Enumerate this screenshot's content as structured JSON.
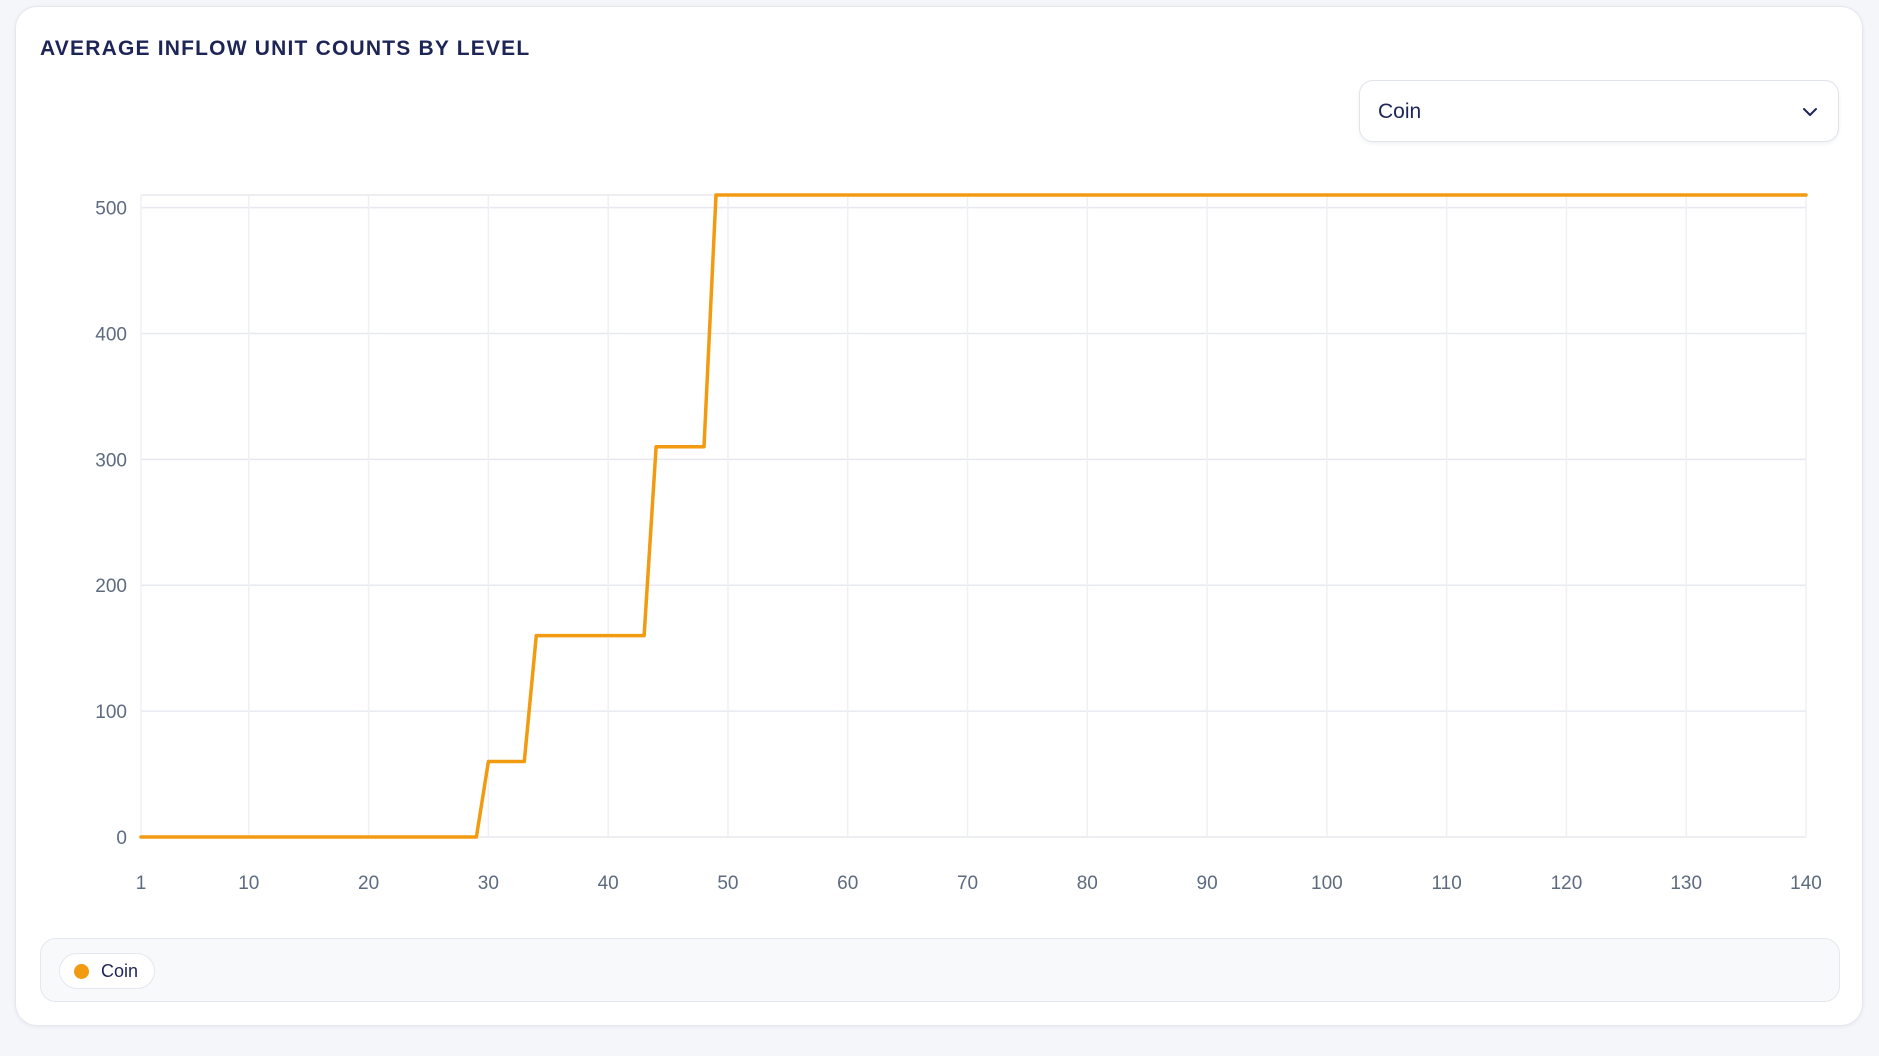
{
  "card": {
    "title": "AVERAGE INFLOW UNIT COUNTS BY LEVEL"
  },
  "dropdown": {
    "selected": "Coin",
    "icon": "chevron-down-icon"
  },
  "legend": {
    "items": [
      {
        "label": "Coin",
        "color": "#f29a10"
      }
    ]
  },
  "chart_data": {
    "type": "line",
    "title": "AVERAGE INFLOW UNIT COUNTS BY LEVEL",
    "xlabel": "",
    "ylabel": "",
    "xlim": [
      1,
      140
    ],
    "ylim": [
      0,
      510
    ],
    "x_ticks": [
      1,
      10,
      20,
      30,
      40,
      50,
      60,
      70,
      80,
      90,
      100,
      110,
      120,
      130,
      140
    ],
    "y_ticks": [
      0,
      100,
      200,
      300,
      400,
      500
    ],
    "grid": true,
    "legend_position": "bottom",
    "series": [
      {
        "name": "Coin",
        "color": "#f29a10",
        "points": [
          [
            1,
            0
          ],
          [
            29,
            0
          ],
          [
            30,
            60
          ],
          [
            33,
            60
          ],
          [
            34,
            160
          ],
          [
            43,
            160
          ],
          [
            44,
            310
          ],
          [
            48,
            310
          ],
          [
            49,
            510
          ],
          [
            140,
            510
          ]
        ]
      }
    ]
  }
}
